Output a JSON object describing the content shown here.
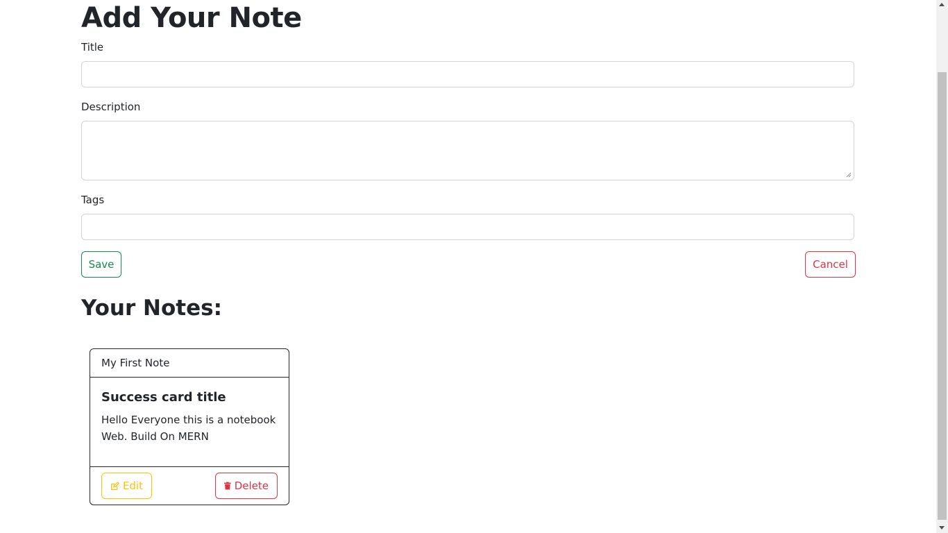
{
  "form": {
    "heading": "Add Your Note",
    "title_label": "Title",
    "title_value": "",
    "description_label": "Description",
    "description_value": "",
    "tags_label": "Tags",
    "tags_value": "",
    "save_label": "Save",
    "cancel_label": "Cancel"
  },
  "notes": {
    "heading": "Your Notes:",
    "items": [
      {
        "header": "My First Note",
        "title": "Success card title",
        "text": "Hello Everyone this is a notebook Web. Build On MERN",
        "edit_label": "Edit",
        "edit_icon": "edit-icon",
        "delete_label": "Delete",
        "delete_icon": "trash-icon"
      }
    ]
  },
  "colors": {
    "success": "#198754",
    "danger": "#dc3545",
    "warning": "#ffc107",
    "text": "#212529"
  }
}
